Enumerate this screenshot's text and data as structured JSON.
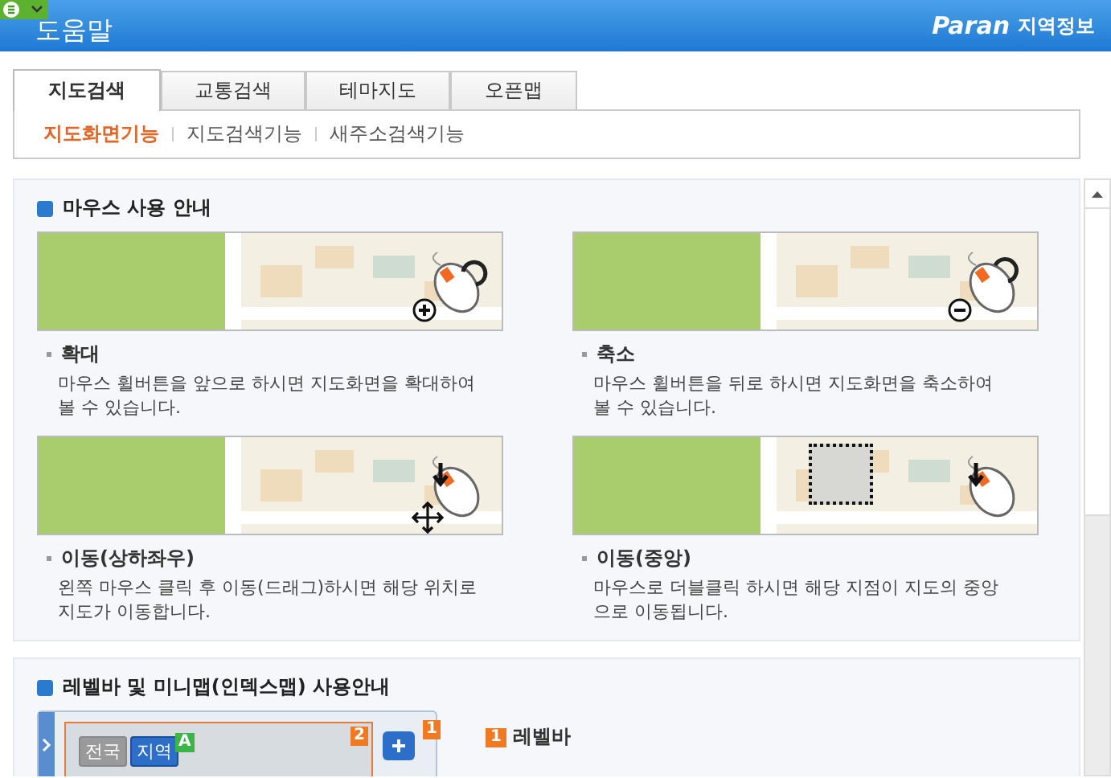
{
  "header": {
    "title": "도움말",
    "brand": "Paran",
    "service": "지역정보"
  },
  "tabs": [
    {
      "label": "지도검색",
      "selected": true
    },
    {
      "label": "교통검색",
      "selected": false
    },
    {
      "label": "테마지도",
      "selected": false
    },
    {
      "label": "오픈맵",
      "selected": false
    }
  ],
  "subtabs": [
    {
      "label": "지도화면기능",
      "selected": true
    },
    {
      "label": "지도검색기능",
      "selected": false
    },
    {
      "label": "새주소검색기능",
      "selected": false
    }
  ],
  "mouse_section": {
    "title": "마우스 사용 안내",
    "cards": [
      {
        "kind": "zoom_in",
        "title": "확대",
        "description": "마우스 휠버튼을 앞으로 하시면 지도화면을 확대하여 볼 수 있습니다."
      },
      {
        "kind": "zoom_out",
        "title": "축소",
        "description": "마우스 휠버튼을 뒤로 하시면 지도화면을 축소하여 볼 수 있습니다."
      },
      {
        "kind": "drag",
        "title": "이동(상하좌우)",
        "description": "왼쪽 마우스 클릭 후 이동(드래그)하시면 해당 위치로 지도가 이동합니다."
      },
      {
        "kind": "center",
        "title": "이동(중앙)",
        "description": "마우스로 더블클릭 하시면 해당 지점이 지도의 중앙으로 이동됩니다."
      }
    ]
  },
  "minimap_section": {
    "title": "레벨바 및 미니맵(인덱스맵) 사용안내",
    "region_buttons": [
      {
        "label": "전국",
        "selected": false
      },
      {
        "label": "지역",
        "selected": true
      }
    ],
    "markers": [
      {
        "kind": "region",
        "label": "A"
      },
      {
        "kind": "map",
        "label": "2"
      },
      {
        "kind": "level",
        "label": "1"
      }
    ],
    "legend": [
      {
        "number": "1",
        "label": "레벨바"
      }
    ]
  }
}
